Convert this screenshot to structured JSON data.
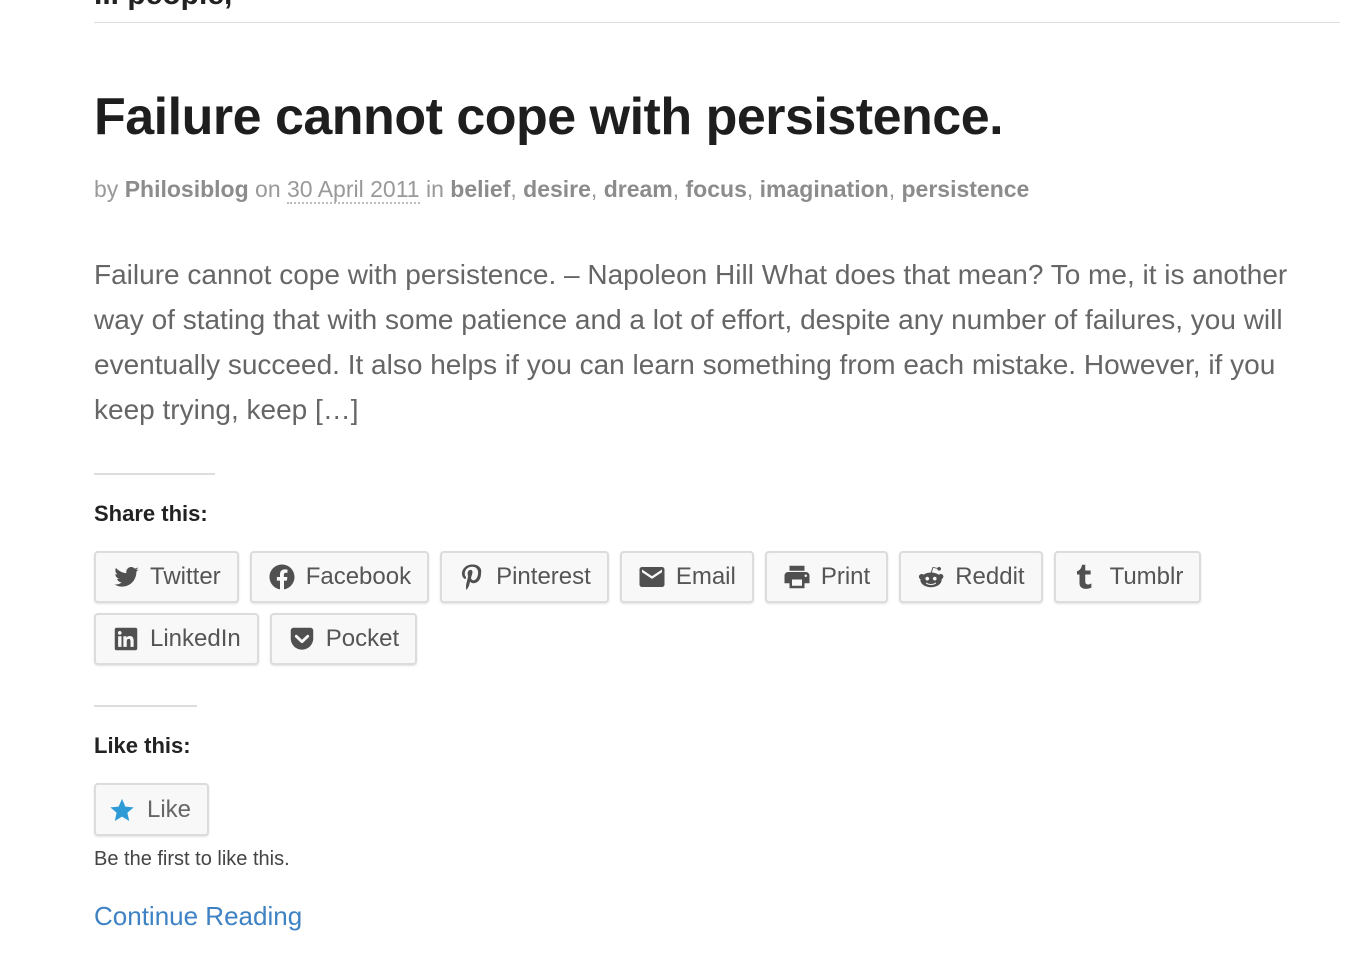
{
  "previous_post": {
    "title_fragment": "... people,"
  },
  "post": {
    "title": "Failure cannot cope with persistence.",
    "meta": {
      "by": "by",
      "author": "Philosiblog",
      "on": "on",
      "date": "30 April 2011",
      "in": "in",
      "categories": [
        "belief",
        "desire",
        "dream",
        "focus",
        "imagination",
        "persistence"
      ],
      "separator": ", "
    },
    "excerpt": "Failure cannot cope with persistence. – Napoleon Hill What does that mean? To me, it is another way of stating that with some patience and a lot of effort, despite any number of failures, you will eventually succeed.  It also helps if you can learn something from each mistake.  However, if you keep trying, keep […]"
  },
  "share": {
    "heading": "Share this:",
    "buttons": [
      {
        "label": "Twitter",
        "icon": "twitter-icon"
      },
      {
        "label": "Facebook",
        "icon": "facebook-icon"
      },
      {
        "label": "Pinterest",
        "icon": "pinterest-icon"
      },
      {
        "label": "Email",
        "icon": "email-icon"
      },
      {
        "label": "Print",
        "icon": "print-icon"
      },
      {
        "label": "Reddit",
        "icon": "reddit-icon"
      },
      {
        "label": "Tumblr",
        "icon": "tumblr-icon"
      },
      {
        "label": "LinkedIn",
        "icon": "linkedin-icon"
      },
      {
        "label": "Pocket",
        "icon": "pocket-icon"
      }
    ]
  },
  "like": {
    "heading": "Like this:",
    "button_label": "Like",
    "icon": "star-icon",
    "note": "Be the first to like this."
  },
  "continue_reading": "Continue Reading",
  "colors": {
    "link": "#3f82c4",
    "like_star": "#2f9bd6",
    "icon_gray": "#505050"
  }
}
